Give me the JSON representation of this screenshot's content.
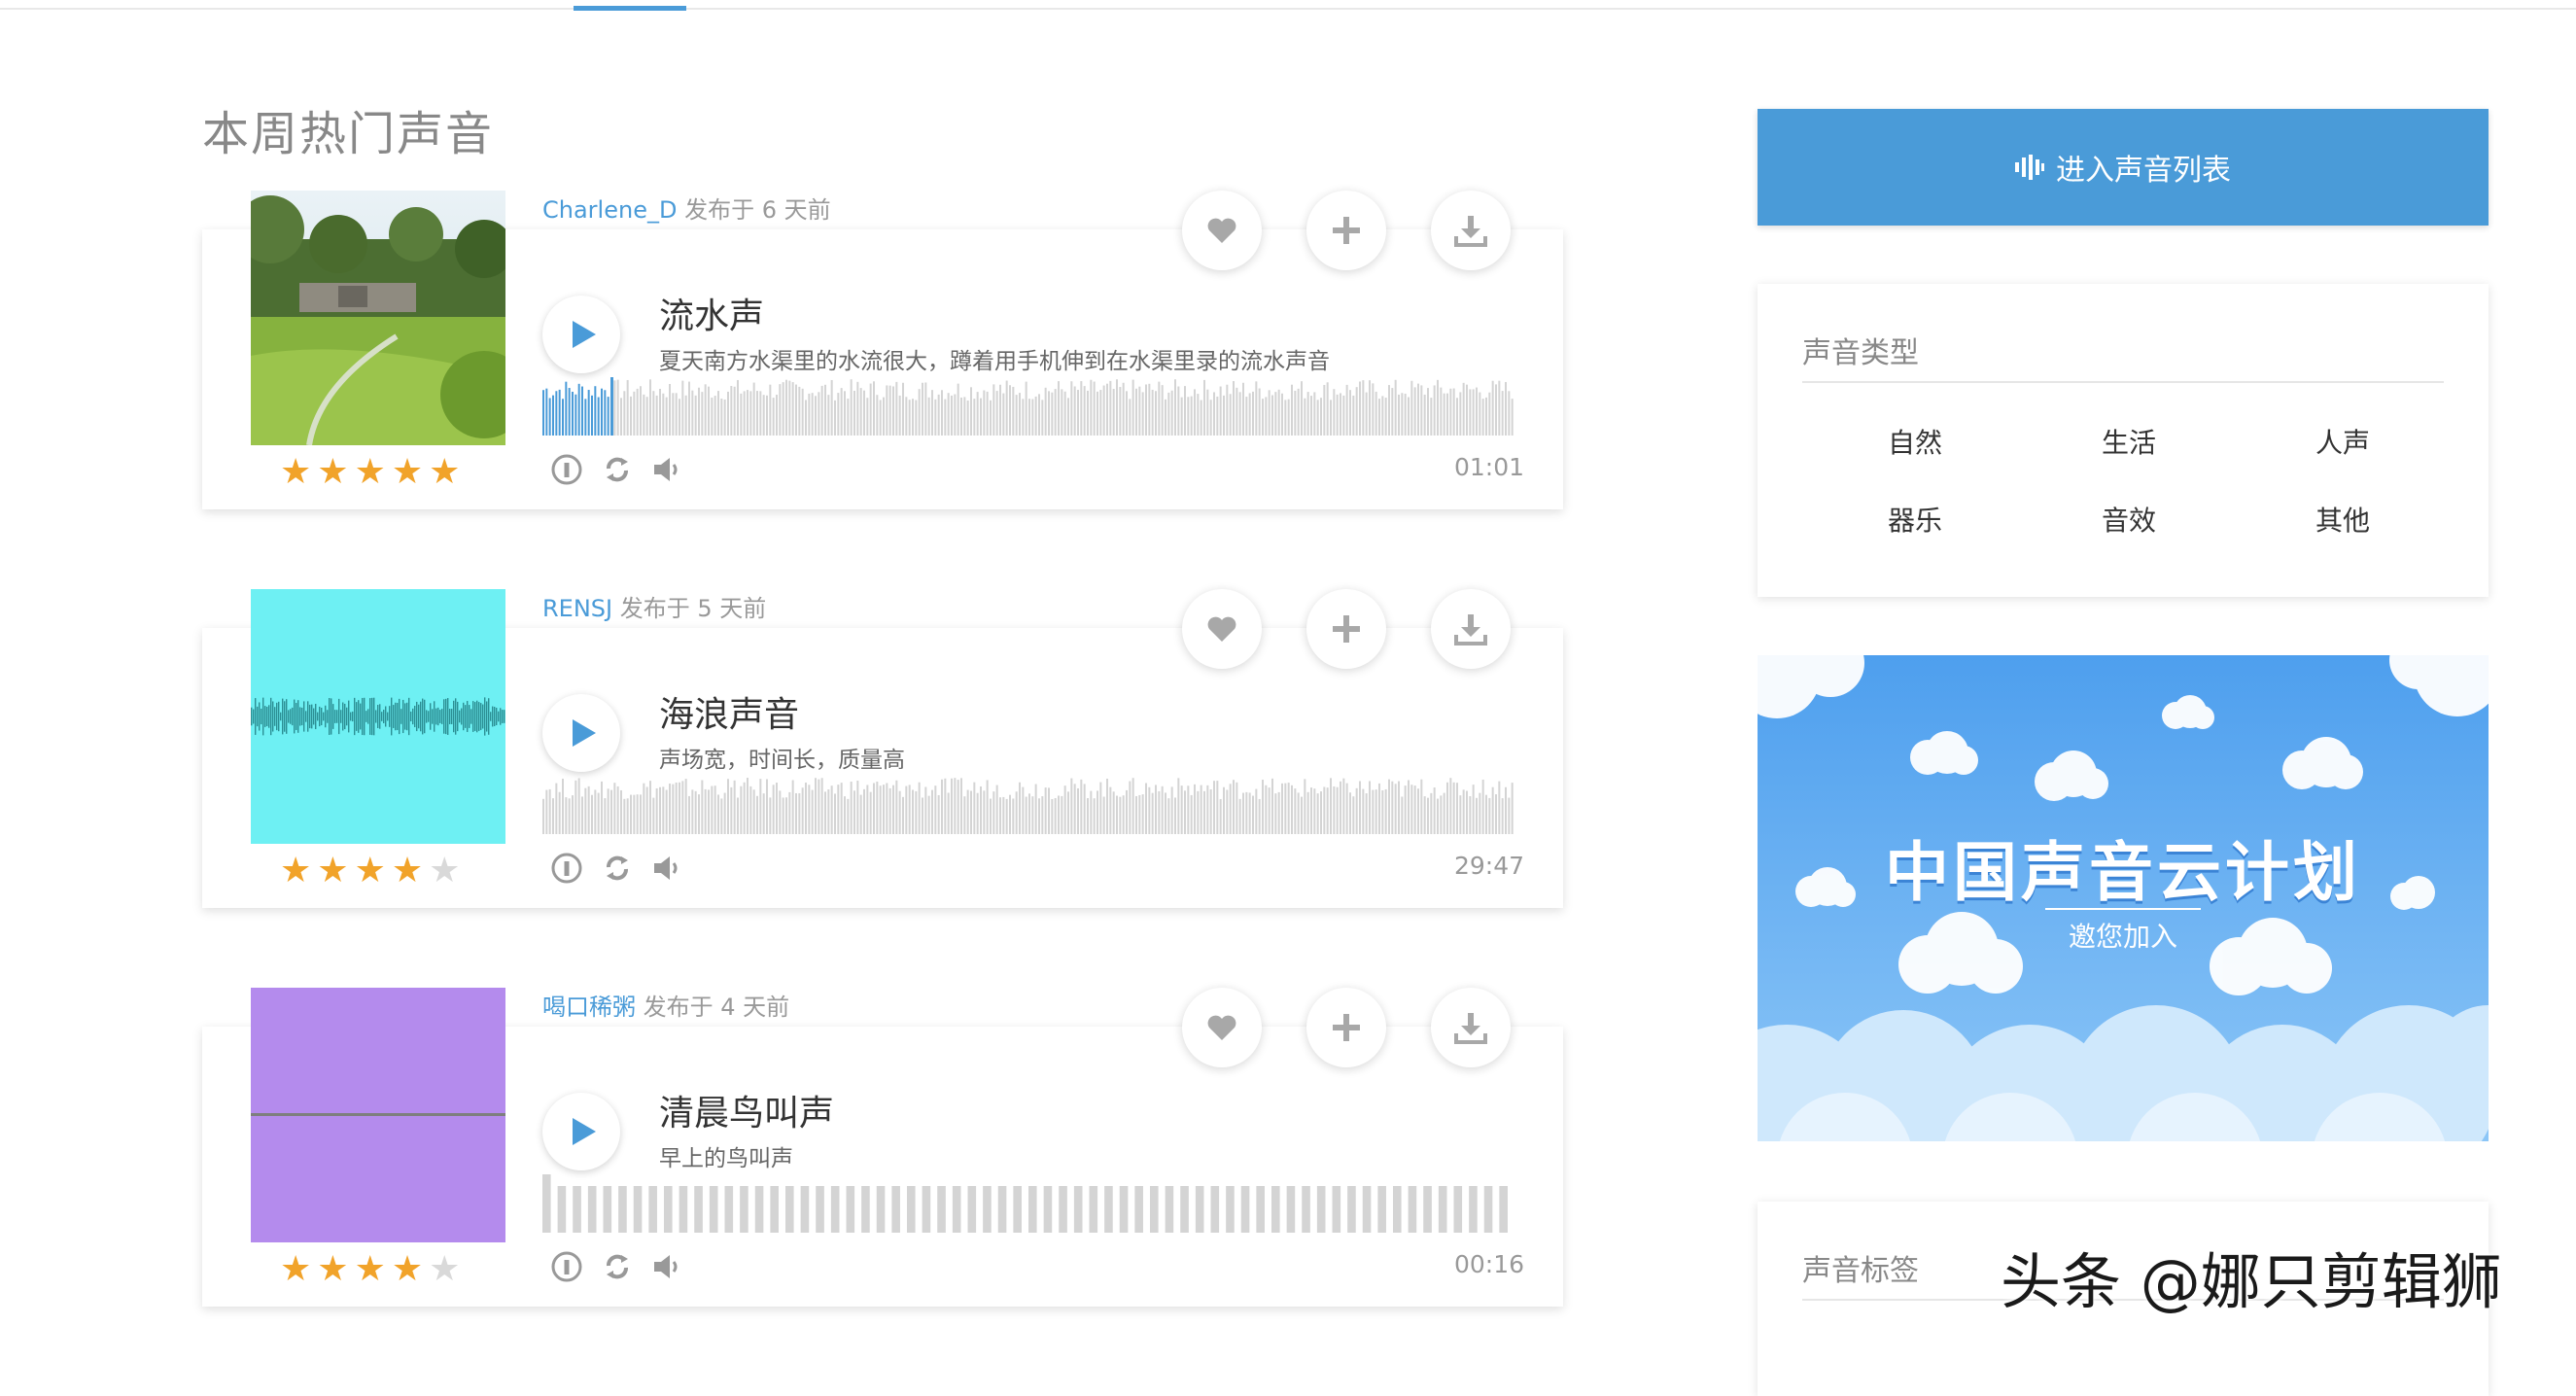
{
  "section_title": "本周热门声音",
  "sounds": [
    {
      "author": "Charlene_D",
      "posted": "发布于 6 天前",
      "title": "流水声",
      "desc": "夏天南方水渠里的水流很大，蹲着用手机伸到在水渠里录的流水声音",
      "duration": "01:01",
      "rating": 5,
      "progress": 0.07,
      "thumb": "landscape"
    },
    {
      "author": "RENSJ",
      "posted": "发布于 5 天前",
      "title": "海浪声音",
      "desc": "声场宽，时间长，质量高",
      "duration": "29:47",
      "rating": 4,
      "progress": 0,
      "thumb": "cyan-wave"
    },
    {
      "author": "喝口稀粥",
      "posted": "发布于 4 天前",
      "title": "清晨鸟叫声",
      "desc": "早上的鸟叫声",
      "duration": "00:16",
      "rating": 4,
      "progress": 0,
      "thumb": "purple-line"
    }
  ],
  "sidebar": {
    "enter_label": "进入声音列表",
    "types_title": "声音类型",
    "types": [
      "自然",
      "生活",
      "人声",
      "器乐",
      "音效",
      "其他"
    ],
    "banner_title": "中国声音云计划",
    "banner_sub": "邀您加入",
    "tags_title": "声音标签"
  },
  "watermark": "头条 @娜只剪辑狮",
  "colors": {
    "accent": "#4a9bd8",
    "star": "#f1a32a",
    "banner_sky": "#5aa9ef"
  }
}
